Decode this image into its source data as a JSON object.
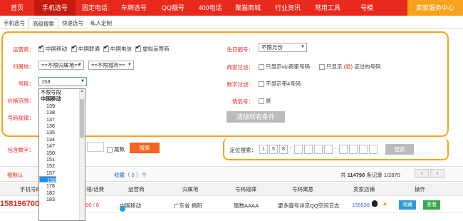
{
  "topnav": {
    "items": [
      "首页",
      "手机选号",
      "固定电话",
      "车牌选号",
      "QQ靓号",
      "400电话",
      "聚猫商城",
      "行业资讯",
      "常用工具",
      "号模"
    ],
    "service": "卖家服务中心"
  },
  "subtabs": [
    "手机选号",
    "高级搜索",
    "快速选号",
    "私人定制"
  ],
  "filters": {
    "carrier_label": "运营商：",
    "carriers": [
      "中国移动",
      "中国联通",
      "中国电信",
      "虚拟运营商"
    ],
    "region_label": "归属地：",
    "province": "==不限归属地==",
    "city": "==不限城市==",
    "segment_label": "号段：",
    "segment_value": "158",
    "price_label": "价格范围：",
    "pattern_label": "号码规律：",
    "contains_label": "包含数字：",
    "tail_label": "尾数",
    "search_btn": "搜索",
    "birthday_label": "生日靓号：",
    "birthday_value": "不限月份",
    "merchant_label": "商家过滤：",
    "merchant_opt1": "只显示vip商家号码",
    "merchant_opt2_pre": "只显示",
    "merchant_opt2_mid": "(验)",
    "merchant_opt2_post": "证过的号码",
    "digit_label": "数字过滤：",
    "digit_opt": "不显示带4号码",
    "couple_label": "情侣号：",
    "couple_opt": "是",
    "clear_btn": "清除所有条件"
  },
  "locate": {
    "label": "定位搜索：",
    "digits": [
      "1",
      "5",
      "8",
      "",
      "",
      "",
      "",
      "",
      "",
      "",
      ""
    ],
    "btn": "搜索"
  },
  "results": {
    "sort_default": "按默认",
    "favorites": "收藏（ 0 ）个",
    "total_pre": "共",
    "total_count": "114790",
    "total_post": "条记录",
    "page": "1/2870",
    "headers": [
      "手机号码",
      "价格/话费",
      "运营商",
      "归属地",
      "号码规律",
      "号码寓意",
      "卖家店铺",
      "操作"
    ],
    "row": {
      "number": "15819670000",
      "price": "800 / 0",
      "carrier": "中国移动",
      "region": "广东省 揭阳",
      "pattern": "尾数AAAA",
      "meaning": "更多靓号详见QQ空间日志",
      "shop": "155536",
      "fav_btn": "收藏",
      "view_btn": "查看"
    }
  },
  "dropdown": {
    "items": [
      "不限号段",
      "中国移动",
      "139",
      "138",
      "137",
      "136",
      "135",
      "134",
      "147",
      "150",
      "151",
      "152",
      "157",
      "158",
      "159",
      "178",
      "182",
      "183"
    ],
    "selected": "158",
    "bold": "中国移动"
  },
  "colors": {
    "brand_red": "#e8291c",
    "accent_orange": "#f6a21d",
    "button_orange": "#f26522",
    "select_blue": "#1e90ff",
    "fav_blue": "#2a9bd8",
    "view_green": "#36a84f"
  }
}
